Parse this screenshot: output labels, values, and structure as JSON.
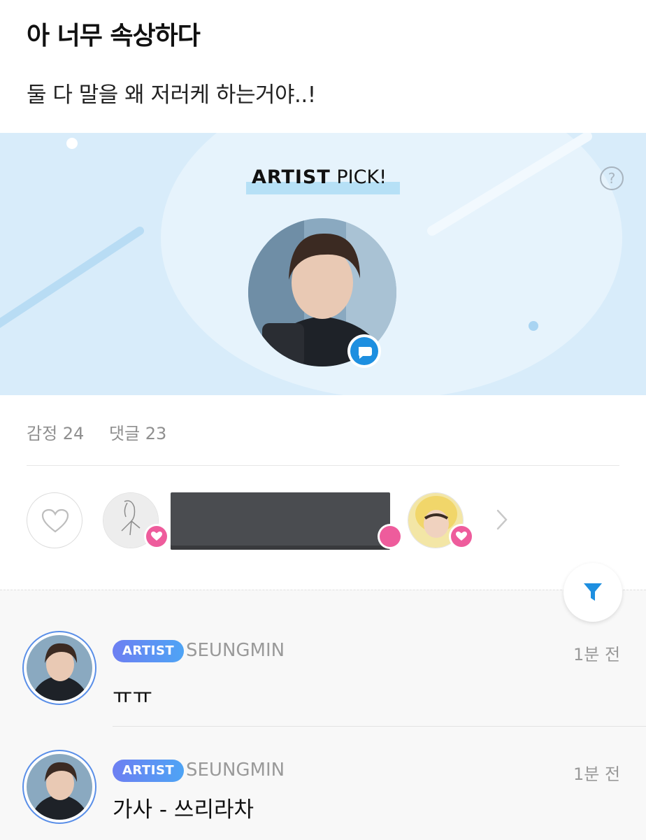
{
  "post": {
    "title": "아 너무 속상하다",
    "body": "둘 다 말을 왜 저러케 하는거야..!"
  },
  "artist_pick": {
    "title_bold": "ARTIST",
    "title_regular": " PICK!",
    "help_icon": "?"
  },
  "stats": {
    "emotions": "감정 24",
    "comments": "댓글 23"
  },
  "comments": [
    {
      "badge": "ARTIST",
      "name": "SEUNGMIN",
      "time": "1분 전",
      "text": "ㅠㅠ"
    },
    {
      "badge": "ARTIST",
      "name": "SEUNGMIN",
      "time": "1분 전",
      "text": "가사 - 쓰리라차"
    }
  ],
  "icons": {
    "help": "question-circle-icon",
    "chat": "chat-bubble-icon",
    "like": "heart-outline-icon",
    "reaction": "heart-filled-icon",
    "next": "chevron-right-icon",
    "filter": "funnel-icon"
  },
  "colors": {
    "banner_bg": "#d8ecfa",
    "accent_blue": "#1e8fe0",
    "heart_pink": "#ee5c9c",
    "badge_gradient_start": "#6d7ff2",
    "badge_gradient_end": "#4ea4f5",
    "muted_text": "#9a9a9a"
  }
}
